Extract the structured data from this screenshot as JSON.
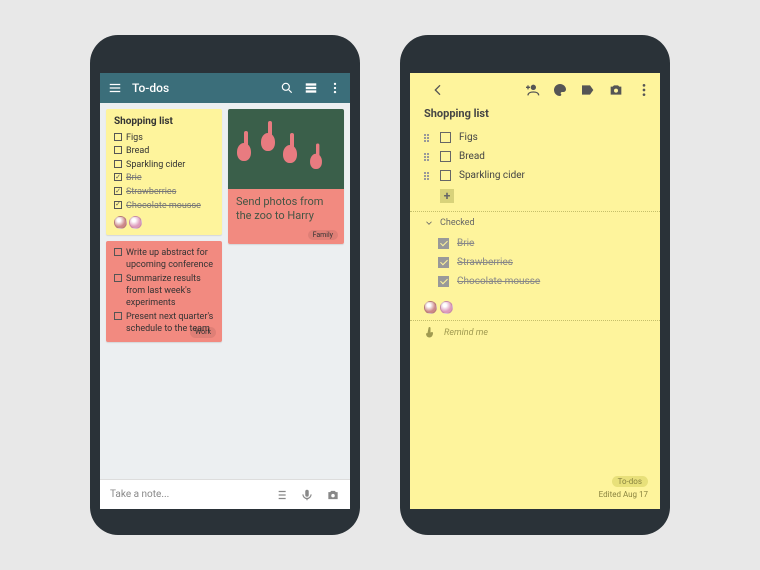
{
  "left": {
    "toolbar_title": "To-dos",
    "note_shopping": {
      "title": "Shopping list",
      "unchecked": [
        "Figs",
        "Bread",
        "Sparkling cider"
      ],
      "checked": [
        "Brie",
        "Strawberries",
        "Chocolate mousse"
      ]
    },
    "note_work": {
      "items": [
        "Write up abstract for upcoming conference",
        "Summarize results from last week's experiments",
        "Present next quarter's schedule to the team"
      ],
      "label": "Work"
    },
    "photo_note": {
      "caption": "Send photos from the zoo to Harry",
      "label": "Family"
    },
    "take_note_placeholder": "Take a note..."
  },
  "right": {
    "title": "Shopping list",
    "unchecked": [
      "Figs",
      "Bread",
      "Sparkling cider"
    ],
    "checked_header": "Checked",
    "checked": [
      "Brie",
      "Strawberries",
      "Chocolate mousse"
    ],
    "remind_placeholder": "Remind me",
    "label": "To-dos",
    "edited": "Edited Aug 17"
  }
}
